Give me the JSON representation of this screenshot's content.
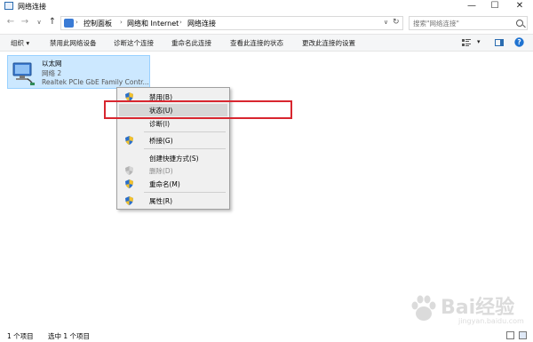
{
  "window": {
    "title": "网络连接",
    "controls": {
      "minimize": "—",
      "maximize": "☐",
      "close": "✕"
    }
  },
  "nav": {
    "back": "←",
    "forward": "→",
    "dropdown": "∨",
    "up": "↑"
  },
  "address": {
    "breadcrumbs": [
      "控制面板",
      "网络和 Internet",
      "网络连接"
    ],
    "separator": "›",
    "dropdown": "∨",
    "refresh": "↻"
  },
  "search": {
    "placeholder": "搜索\"网络连接\""
  },
  "toolbar": {
    "items": [
      "组织 ▾",
      "禁用此网络设备",
      "诊断这个连接",
      "重命名此连接",
      "查看此连接的状态",
      "更改此连接的设置"
    ],
    "view_dd": "▾"
  },
  "connection": {
    "name": "以太网",
    "network": "网络  2",
    "adapter": "Realtek PCIe GbE Family Contr..."
  },
  "context_menu": {
    "items": [
      {
        "label": "禁用(B)",
        "shield": true,
        "disabled": false
      },
      {
        "label": "状态(U)",
        "shield": false,
        "disabled": false,
        "hover": true
      },
      {
        "label": "诊断(I)",
        "shield": false,
        "disabled": false
      },
      {
        "label": "桥接(G)",
        "shield": true,
        "disabled": false
      },
      {
        "label": "创建快捷方式(S)",
        "shield": false,
        "disabled": false
      },
      {
        "label": "删除(D)",
        "shield": true,
        "disabled": true
      },
      {
        "label": "重命名(M)",
        "shield": true,
        "disabled": false
      },
      {
        "label": "属性(R)",
        "shield": true,
        "disabled": false
      }
    ]
  },
  "status": {
    "count": "1 个项目",
    "selected": "选中 1 个项目"
  },
  "watermark": {
    "brand": "Bai",
    "brand2": "经验",
    "url": "jingyan.baidu.com"
  },
  "colors": {
    "highlight": "#d8262f",
    "selection": "#cce8ff",
    "menu_bg": "#f0f0f0"
  }
}
